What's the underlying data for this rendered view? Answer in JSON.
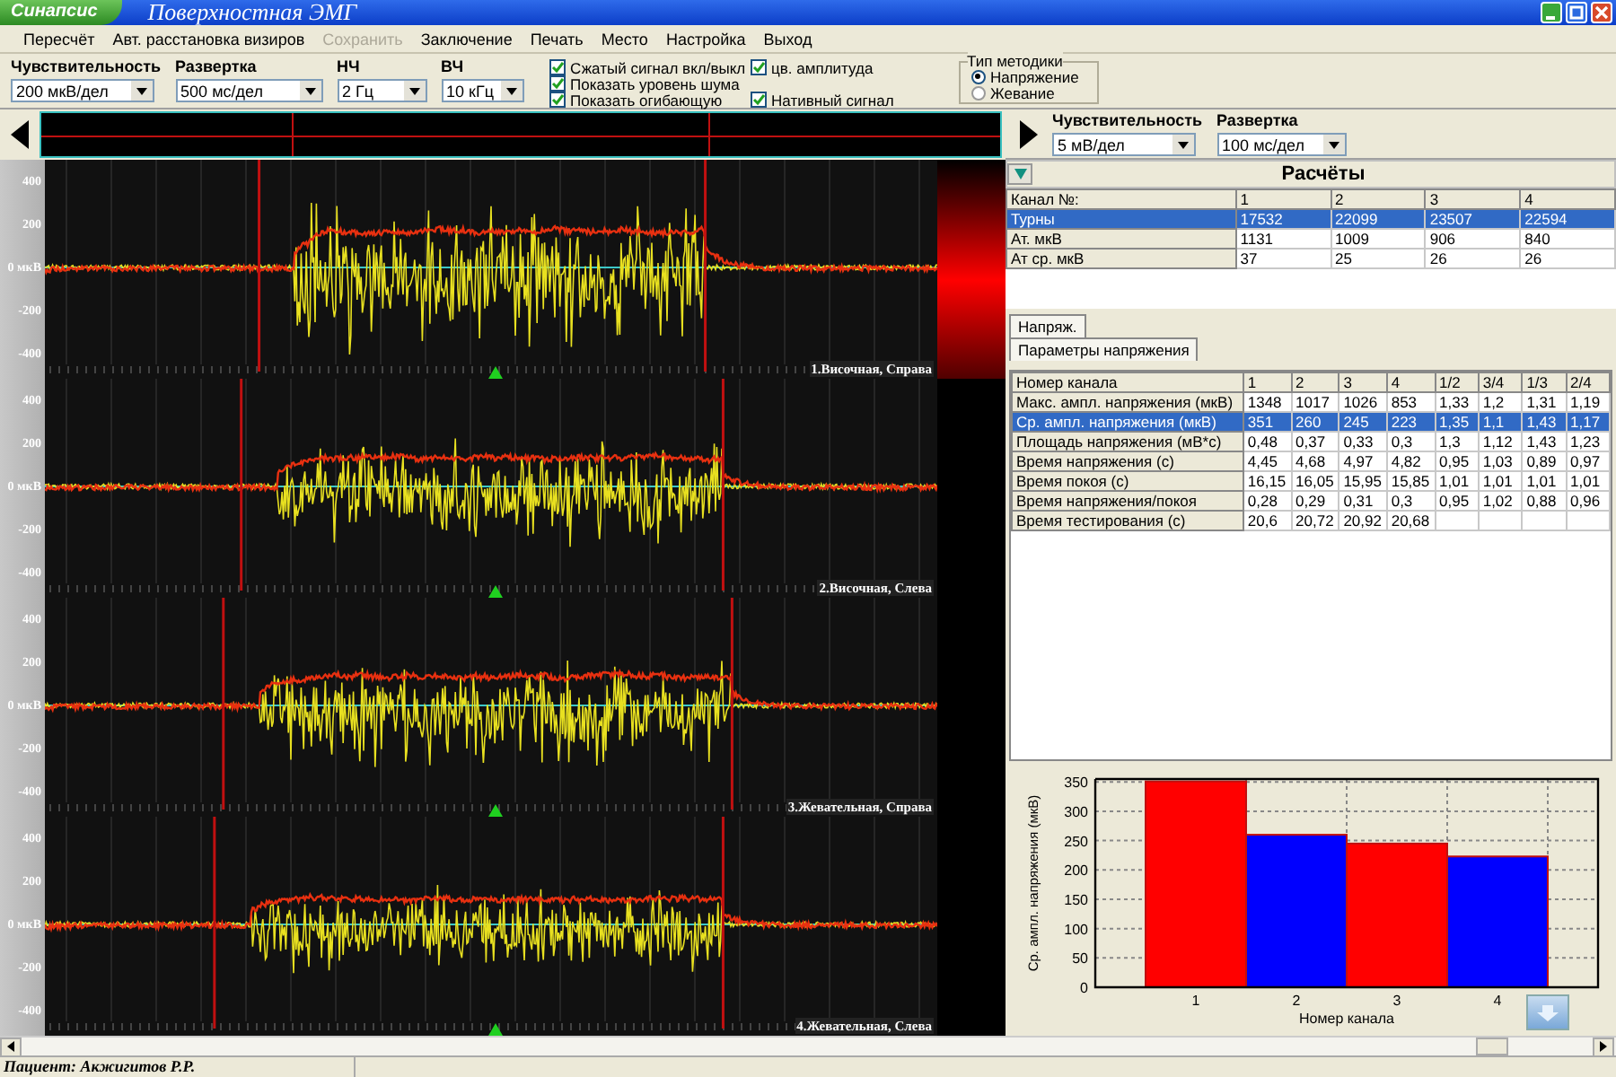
{
  "window": {
    "app_badge": "Синапсис",
    "title": "Поверхностная ЭМГ"
  },
  "menu": [
    {
      "label": "Пересчёт",
      "disabled": false
    },
    {
      "label": "Авт. расстановка визиров",
      "disabled": false
    },
    {
      "label": "Сохранить",
      "disabled": true
    },
    {
      "label": "Заключение",
      "disabled": false
    },
    {
      "label": "Печать",
      "disabled": false
    },
    {
      "label": "Место",
      "disabled": false
    },
    {
      "label": "Настройка",
      "disabled": false
    },
    {
      "label": "Выход",
      "disabled": false
    }
  ],
  "toolbar": {
    "dropdowns": [
      {
        "label": "Чувствительность",
        "value": "200 мкВ/дел"
      },
      {
        "label": "Развертка",
        "value": "500 мс/дел"
      },
      {
        "label": "НЧ",
        "value": "2 Гц"
      },
      {
        "label": "ВЧ",
        "value": "10 кГц"
      }
    ],
    "checkboxes": [
      {
        "label": "Сжатый сигнал вкл/выкл",
        "checked": true
      },
      {
        "label": "Показать уровень шума",
        "checked": true
      },
      {
        "label": "Показать огибающую",
        "checked": true
      },
      {
        "label": "цв. амплитуда",
        "checked": true
      },
      {
        "label": "Нативный сигнал",
        "checked": true
      }
    ],
    "method": {
      "title": "Тип методики",
      "options": [
        {
          "label": "Напряжение",
          "selected": true
        },
        {
          "label": "Жевание",
          "selected": false
        }
      ]
    }
  },
  "channels": [
    {
      "label": "1.Височная, Справа",
      "axis": [
        "400",
        "200",
        "0 мкВ",
        "-200",
        "-400"
      ]
    },
    {
      "label": "2.Височная, Слева",
      "axis": [
        "400",
        "200",
        "0 мкВ",
        "-200",
        "-400"
      ]
    },
    {
      "label": "3.Жевательная, Справа",
      "axis": [
        "400",
        "200",
        "0 мкВ",
        "-200",
        "-400"
      ]
    },
    {
      "label": "4.Жевательная, Слева",
      "axis": [
        "400",
        "200",
        "0 мкВ",
        "-200",
        "-400"
      ]
    }
  ],
  "analysis": {
    "dropdowns": [
      {
        "label": "Чувствительность",
        "value": "5 мВ/дел"
      },
      {
        "label": "Развертка",
        "value": "100 мс/дел"
      }
    ],
    "calc": {
      "title": "Расчёты",
      "columns": [
        "Канал №:",
        "1",
        "2",
        "3",
        "4"
      ],
      "rows": [
        {
          "cells": [
            "Турны",
            "17532",
            "22099",
            "23507",
            "22594"
          ],
          "selected": true
        },
        {
          "cells": [
            "Ат. мкВ",
            "1131",
            "1009",
            "906",
            "840"
          ],
          "selected": false
        },
        {
          "cells": [
            "Ат ср. мкВ",
            "37",
            "25",
            "26",
            "26"
          ],
          "selected": false
        }
      ]
    },
    "tabs": [
      {
        "label": "Напряж.",
        "selected": true
      }
    ],
    "subtabs": [
      {
        "label": "Параметры напряжения",
        "selected": true
      }
    ],
    "params": {
      "columns": [
        "Номер канала",
        "1",
        "2",
        "3",
        "4",
        "1/2",
        "3/4",
        "1/3",
        "2/4"
      ],
      "rows": [
        {
          "cells": [
            "Макс. ампл. напряжения (мкВ)",
            "1348",
            "1017",
            "1026",
            "853",
            "1,33",
            "1,2",
            "1,31",
            "1,19"
          ],
          "selected": false
        },
        {
          "cells": [
            "Ср. ампл. напряжения (мкВ)",
            "351",
            "260",
            "245",
            "223",
            "1,35",
            "1,1",
            "1,43",
            "1,17"
          ],
          "selected": true
        },
        {
          "cells": [
            "Площадь напряжения (мВ*с)",
            "0,48",
            "0,37",
            "0,33",
            "0,3",
            "1,3",
            "1,12",
            "1,43",
            "1,23"
          ],
          "selected": false
        },
        {
          "cells": [
            "Время напряжения (с)",
            "4,45",
            "4,68",
            "4,97",
            "4,82",
            "0,95",
            "1,03",
            "0,89",
            "0,97"
          ],
          "selected": false
        },
        {
          "cells": [
            "Время покоя (с)",
            "16,15",
            "16,05",
            "15,95",
            "15,85",
            "1,01",
            "1,01",
            "1,01",
            "1,01"
          ],
          "selected": false
        },
        {
          "cells": [
            "Время напряжения/покоя",
            "0,28",
            "0,29",
            "0,31",
            "0,3",
            "0,95",
            "1,02",
            "0,88",
            "0,96"
          ],
          "selected": false
        },
        {
          "cells": [
            "Время тестирования (с)",
            "20,6",
            "20,72",
            "20,92",
            "20,68",
            "",
            "",
            "",
            ""
          ],
          "selected": false
        }
      ]
    },
    "chart_data": {
      "type": "bar",
      "xlabel": "Номер канала",
      "ylabel": "Ср. ампл. напряжения (мкВ)",
      "categories": [
        "1",
        "2",
        "3",
        "4"
      ],
      "series": [
        {
          "color": "#ff0000",
          "values": [
            351,
            null,
            245,
            null
          ]
        },
        {
          "color": "#0000ff",
          "values": [
            null,
            260,
            null,
            223
          ]
        }
      ],
      "ylim": [
        0,
        355
      ],
      "yticks": [
        0,
        50,
        100,
        150,
        200,
        250,
        300,
        350
      ],
      "grid": true
    }
  },
  "status_bar": {
    "patient": "Пациент: Акжигитов Р.Р."
  }
}
